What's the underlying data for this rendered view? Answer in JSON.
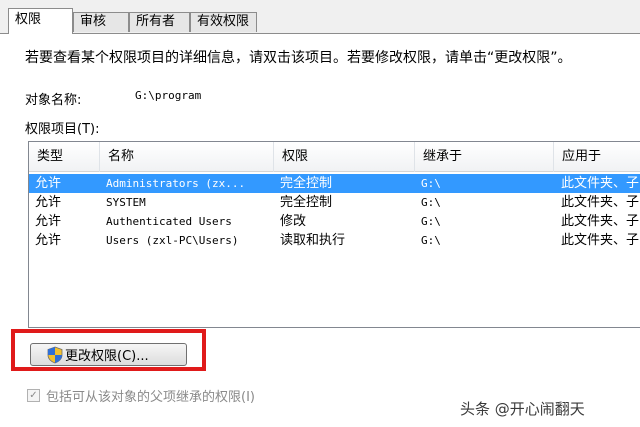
{
  "tabs": [
    {
      "label": "权限",
      "active": true
    },
    {
      "label": "审核",
      "active": false
    },
    {
      "label": "所有者",
      "active": false
    },
    {
      "label": "有效权限",
      "active": false
    }
  ],
  "intro_text": "若要查看某个权限项目的详细信息，请双击该项目。若要修改权限，请单击“更改权限”。",
  "object_name": {
    "label": "对象名称:",
    "value": "G:\\program"
  },
  "permissions_label": "权限项目(T):",
  "columns": [
    "类型",
    "名称",
    "权限",
    "继承于",
    "应用于"
  ],
  "rows": [
    {
      "type": "允许",
      "name": "Administrators (zx...",
      "permission": "完全控制",
      "inherited": "G:\\",
      "applies": "此文件夹、子",
      "selected": true
    },
    {
      "type": "允许",
      "name": "SYSTEM",
      "permission": "完全控制",
      "inherited": "G:\\",
      "applies": "此文件夹、子",
      "selected": false
    },
    {
      "type": "允许",
      "name": "Authenticated Users",
      "permission": "修改",
      "inherited": "G:\\",
      "applies": "此文件夹、子",
      "selected": false
    },
    {
      "type": "允许",
      "name": "Users (zxl-PC\\Users)",
      "permission": "读取和执行",
      "inherited": "G:\\",
      "applies": "此文件夹、子",
      "selected": false
    }
  ],
  "change_button": "更改权限(C)...",
  "inherit_checkbox": {
    "label": "包括可从该对象的父项继承的权限(I)",
    "checked": true
  },
  "watermark": "头条 @开心闹翻天",
  "colors": {
    "selection": "#3399ff",
    "highlight_box": "#e01a1a"
  }
}
